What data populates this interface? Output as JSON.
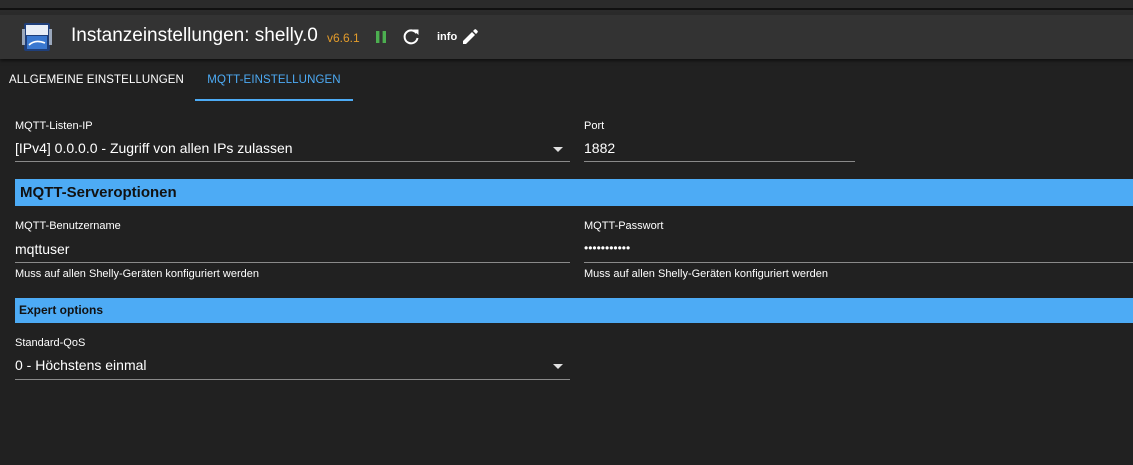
{
  "header": {
    "title": "Instanzeinstellungen: shelly.0",
    "version": "v6.6.1",
    "version_color": "#e29b2b",
    "pause_icon_color": "#4caf50",
    "info_label": "info"
  },
  "tabs": [
    {
      "label": "ALLGEMEINE EINSTELLUNGEN",
      "active": false
    },
    {
      "label": "MQTT-EINSTELLUNGEN",
      "active": true
    }
  ],
  "accent_color": "#4dabf5",
  "form": {
    "listen_ip": {
      "label": "MQTT-Listen-IP",
      "value": "[IPv4] 0.0.0.0 - Zugriff von allen IPs zulassen"
    },
    "port": {
      "label": "Port",
      "value": "1882"
    },
    "server_section": "MQTT-Serveroptionen",
    "username": {
      "label": "MQTT-Benutzername",
      "value": "mqttuser",
      "helper": "Muss auf allen Shelly-Geräten konfiguriert werden"
    },
    "password": {
      "label": "MQTT-Passwort",
      "value": "•••••••••••",
      "helper": "Muss auf allen Shelly-Geräten konfiguriert werden"
    },
    "expert_section": "Expert options",
    "qos": {
      "label": "Standard-QoS",
      "value": "0 - Höchstens einmal"
    }
  }
}
